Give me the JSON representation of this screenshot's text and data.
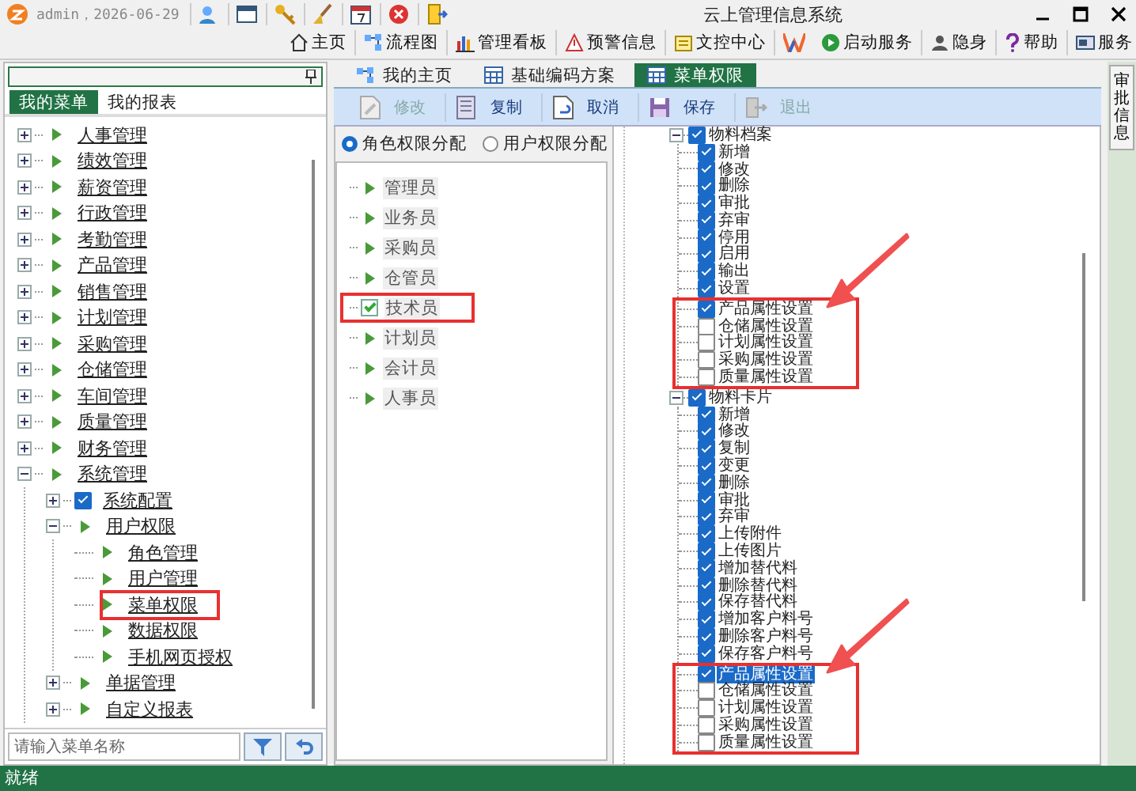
{
  "window": {
    "title": "云上管理信息系统",
    "user": "admin，2026-06-29"
  },
  "nav_buttons": [
    {
      "label": "主页"
    },
    {
      "label": "流程图"
    },
    {
      "label": "管理看板"
    },
    {
      "label": "预警信息"
    },
    {
      "label": "文控中心"
    },
    {
      "label": "启动服务"
    },
    {
      "label": "隐身"
    },
    {
      "label": "帮助"
    },
    {
      "label": "服务"
    }
  ],
  "sidebar": {
    "tabs": [
      {
        "label": "我的菜单",
        "selected": true
      },
      {
        "label": "我的报表",
        "selected": false
      }
    ],
    "menu_tree": [
      {
        "label": "人事管理",
        "kind": "group",
        "expanded": false
      },
      {
        "label": "绩效管理",
        "kind": "group",
        "expanded": false
      },
      {
        "label": "薪资管理",
        "kind": "group",
        "expanded": false
      },
      {
        "label": "行政管理",
        "kind": "group",
        "expanded": false
      },
      {
        "label": "考勤管理",
        "kind": "group",
        "expanded": false
      },
      {
        "label": "产品管理",
        "kind": "group",
        "expanded": false
      },
      {
        "label": "销售管理",
        "kind": "group",
        "expanded": false
      },
      {
        "label": "计划管理",
        "kind": "group",
        "expanded": false
      },
      {
        "label": "采购管理",
        "kind": "group",
        "expanded": false
      },
      {
        "label": "仓储管理",
        "kind": "group",
        "expanded": false
      },
      {
        "label": "车间管理",
        "kind": "group",
        "expanded": false
      },
      {
        "label": "质量管理",
        "kind": "group",
        "expanded": false
      },
      {
        "label": "财务管理",
        "kind": "group",
        "expanded": false
      },
      {
        "label": "系统管理",
        "kind": "group",
        "expanded": true,
        "children": [
          {
            "label": "系统配置",
            "kind": "checkbox",
            "expanded": false,
            "checked": true
          },
          {
            "label": "用户权限",
            "kind": "group",
            "expanded": true,
            "children": [
              {
                "label": "角色管理",
                "kind": "leaf",
                "highlighted": false
              },
              {
                "label": "用户管理",
                "kind": "leaf",
                "highlighted": false
              },
              {
                "label": "菜单权限",
                "kind": "leaf",
                "highlighted": true
              },
              {
                "label": "数据权限",
                "kind": "leaf",
                "highlighted": false
              },
              {
                "label": "手机网页授权",
                "kind": "leaf",
                "highlighted": false
              }
            ]
          },
          {
            "label": "单据管理",
            "kind": "group",
            "expanded": false
          },
          {
            "label": "自定义报表",
            "kind": "group",
            "expanded": false
          }
        ]
      }
    ],
    "search": {
      "placeholder": "请输入菜单名称"
    }
  },
  "doc_tabs": [
    {
      "label": "我的主页",
      "selected": false
    },
    {
      "label": "基础编码方案",
      "selected": false
    },
    {
      "label": "菜单权限",
      "selected": true
    }
  ],
  "toolbar": [
    {
      "label": "修改",
      "disabled": true
    },
    {
      "label": "复制",
      "disabled": false
    },
    {
      "label": "取消",
      "disabled": false
    },
    {
      "label": "保存",
      "disabled": false
    },
    {
      "label": "退出",
      "disabled": true
    }
  ],
  "assignment_modes": [
    {
      "label": "角色权限分配",
      "selected": true
    },
    {
      "label": "用户权限分配",
      "selected": false
    }
  ],
  "roles": [
    {
      "label": "管理员",
      "kind": "leaf",
      "highlighted": false
    },
    {
      "label": "业务员",
      "kind": "leaf",
      "highlighted": false
    },
    {
      "label": "采购员",
      "kind": "leaf",
      "highlighted": false
    },
    {
      "label": "仓管员",
      "kind": "leaf",
      "highlighted": false
    },
    {
      "label": "技术员",
      "kind": "checkbox",
      "checked": true,
      "highlighted": true
    },
    {
      "label": "计划员",
      "kind": "leaf",
      "highlighted": false
    },
    {
      "label": "会计员",
      "kind": "leaf",
      "highlighted": false
    },
    {
      "label": "人事员",
      "kind": "leaf",
      "highlighted": false
    }
  ],
  "permission_tree": [
    {
      "label": "物料档案",
      "checked": true,
      "expanded": true,
      "actions": [
        {
          "label": "新增",
          "checked": true,
          "selected": false
        },
        {
          "label": "修改",
          "checked": true,
          "selected": false
        },
        {
          "label": "删除",
          "checked": true,
          "selected": false
        },
        {
          "label": "审批",
          "checked": true,
          "selected": false
        },
        {
          "label": "弃审",
          "checked": true,
          "selected": false
        },
        {
          "label": "停用",
          "checked": true,
          "selected": false
        },
        {
          "label": "启用",
          "checked": true,
          "selected": false
        },
        {
          "label": "输出",
          "checked": true,
          "selected": false
        },
        {
          "label": "设置",
          "checked": true,
          "selected": false
        }
      ],
      "settings": {
        "highlighted": true,
        "items": [
          {
            "label": "产品属性设置",
            "checked": true,
            "selected": false
          },
          {
            "label": "仓储属性设置",
            "checked": false,
            "selected": false
          },
          {
            "label": "计划属性设置",
            "checked": false,
            "selected": false
          },
          {
            "label": "采购属性设置",
            "checked": false,
            "selected": false
          },
          {
            "label": "质量属性设置",
            "checked": false,
            "selected": false
          }
        ]
      }
    },
    {
      "label": "物料卡片",
      "checked": true,
      "expanded": true,
      "actions": [
        {
          "label": "新增",
          "checked": true,
          "selected": false
        },
        {
          "label": "修改",
          "checked": true,
          "selected": false
        },
        {
          "label": "复制",
          "checked": true,
          "selected": false
        },
        {
          "label": "变更",
          "checked": true,
          "selected": false
        },
        {
          "label": "删除",
          "checked": true,
          "selected": false
        },
        {
          "label": "审批",
          "checked": true,
          "selected": false
        },
        {
          "label": "弃审",
          "checked": true,
          "selected": false
        },
        {
          "label": "上传附件",
          "checked": true,
          "selected": false
        },
        {
          "label": "上传图片",
          "checked": true,
          "selected": false
        },
        {
          "label": "增加替代料",
          "checked": true,
          "selected": false
        },
        {
          "label": "删除替代料",
          "checked": true,
          "selected": false
        },
        {
          "label": "保存替代料",
          "checked": true,
          "selected": false
        },
        {
          "label": "增加客户料号",
          "checked": true,
          "selected": false
        },
        {
          "label": "删除客户料号",
          "checked": true,
          "selected": false
        },
        {
          "label": "保存客户料号",
          "checked": true,
          "selected": false
        }
      ],
      "settings": {
        "highlighted": true,
        "items": [
          {
            "label": "产品属性设置",
            "checked": true,
            "selected": true
          },
          {
            "label": "仓储属性设置",
            "checked": false,
            "selected": false
          },
          {
            "label": "计划属性设置",
            "checked": false,
            "selected": false
          },
          {
            "label": "采购属性设置",
            "checked": false,
            "selected": false
          },
          {
            "label": "质量属性设置",
            "checked": false,
            "selected": false
          }
        ]
      }
    }
  ],
  "side_tab": {
    "label": "审批信息"
  },
  "status_bar": {
    "text": "就绪"
  }
}
